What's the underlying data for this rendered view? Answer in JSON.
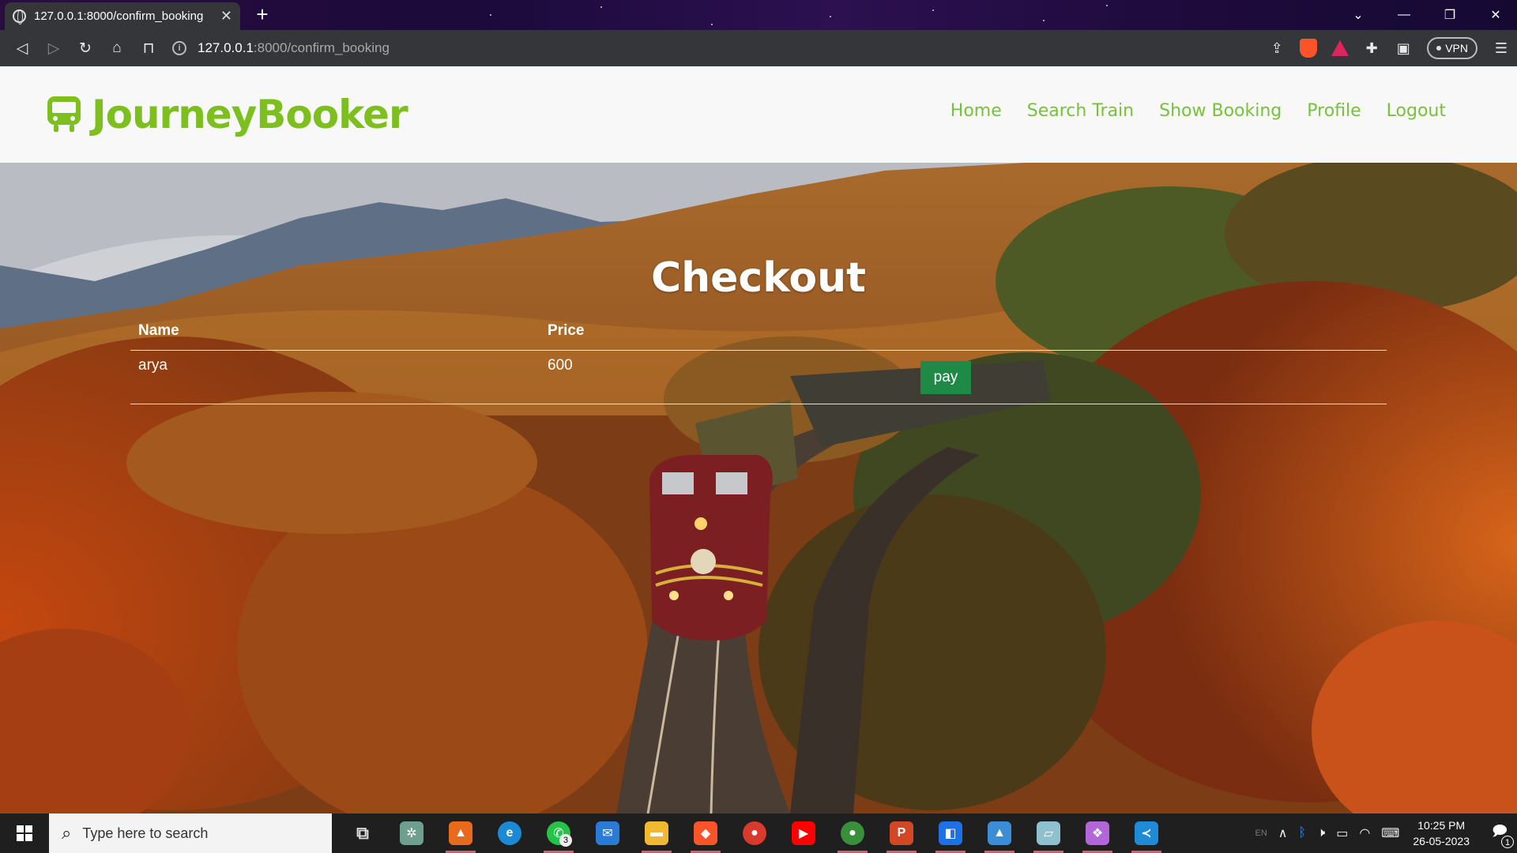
{
  "browser": {
    "tab_title": "127.0.0.1:8000/confirm_booking",
    "tab_close": "✕",
    "new_tab": "+",
    "url_host": "127.0.0.1",
    "url_path": ":8000/confirm_booking",
    "vpn_label": "VPN"
  },
  "site": {
    "brand": "JourneyBooker",
    "brand_color": "#7cbf1e",
    "nav": [
      {
        "label": "Home",
        "active": true
      },
      {
        "label": "Search Train"
      },
      {
        "label": "Show Booking"
      },
      {
        "label": "Profile"
      },
      {
        "label": "Logout"
      }
    ]
  },
  "checkout": {
    "title": "Checkout",
    "columns": [
      "Name",
      "Price"
    ],
    "rows": [
      {
        "name": "arya",
        "price": "600",
        "action": "pay"
      }
    ],
    "pay_color": "#1f8a46"
  },
  "taskbar": {
    "search_placeholder": "Type here to search",
    "apps": [
      {
        "icon": "task-view-icon"
      },
      {
        "icon": "chatgpt-icon"
      },
      {
        "icon": "app-store-icon"
      },
      {
        "icon": "edge-icon"
      },
      {
        "icon": "whatsapp-icon",
        "badge": "3"
      },
      {
        "icon": "mail-icon"
      },
      {
        "icon": "file-explorer-icon"
      },
      {
        "icon": "brave-icon"
      },
      {
        "icon": "chrome-icon"
      },
      {
        "icon": "youtube-icon"
      },
      {
        "icon": "chrome-profile-icon"
      },
      {
        "icon": "powerpoint-icon"
      },
      {
        "icon": "flowchart-icon"
      },
      {
        "icon": "photos-icon"
      },
      {
        "icon": "notes-icon"
      },
      {
        "icon": "figma-icon"
      },
      {
        "icon": "vscode-icon"
      }
    ],
    "lang": "EN",
    "time": "10:25 PM",
    "date": "26-05-2023",
    "notification_count": "1"
  }
}
